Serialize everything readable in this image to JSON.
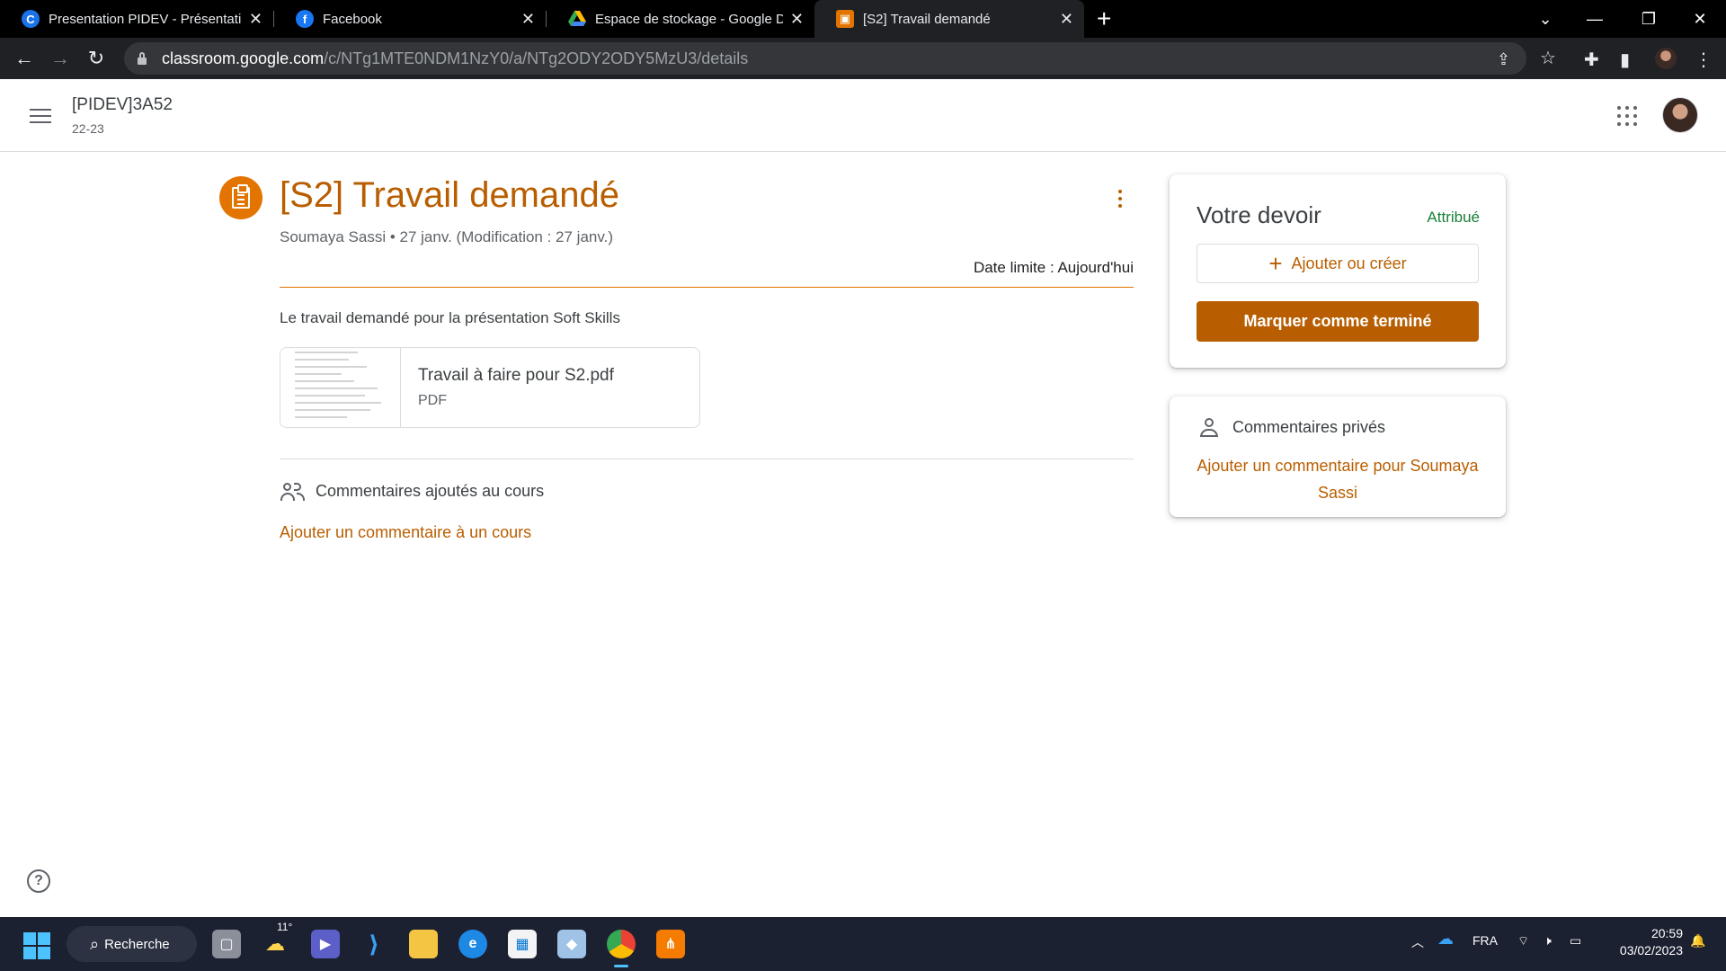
{
  "browser": {
    "tabs": [
      {
        "title": "Presentation PIDEV - Présentation",
        "favicon": "canva-icon",
        "color": "#1a73e8"
      },
      {
        "title": "Facebook",
        "favicon": "facebook-icon",
        "color": "#1877f2"
      },
      {
        "title": "Espace de stockage - Google Drive",
        "favicon": "google-drive-icon",
        "color": "#34a853"
      },
      {
        "title": "[S2] Travail demandé",
        "favicon": "classroom-assignment-icon",
        "color": "#e37400",
        "active": true
      }
    ],
    "url_host": "classroom.google.com",
    "url_path": "/c/NTg1MTE0NDM1NzY0/a/NTg2ODY2ODY5MzU3/details"
  },
  "header": {
    "class_name": "[PIDEV]3A52",
    "class_section": "22-23"
  },
  "assignment": {
    "title": "[S2] Travail demandé",
    "meta": "Soumaya Sassi • 27 janv. (Modification : 27 janv.)",
    "due": "Date limite : Aujourd'hui",
    "description": "Le travail demandé pour la présentation Soft Skills",
    "attachment": {
      "name": "Travail à faire pour S2.pdf",
      "type": "PDF"
    },
    "class_comments_title": "Commentaires ajoutés au cours",
    "add_class_comment": "Ajouter un commentaire à un cours"
  },
  "your_work": {
    "title": "Votre devoir",
    "status": "Attribué",
    "add_button": "Ajouter ou créer",
    "done_button": "Marquer comme terminé"
  },
  "private_comments": {
    "title": "Commentaires privés",
    "add_link": "Ajouter un commentaire pour Soumaya Sassi"
  },
  "taskbar": {
    "search_label": "Recherche",
    "weather_temp": "11°",
    "language": "FRA",
    "time": "20:59",
    "date": "03/02/2023"
  },
  "colors": {
    "accent": "#b95e00",
    "accent_light": "#e37400",
    "status_green": "#188038"
  }
}
